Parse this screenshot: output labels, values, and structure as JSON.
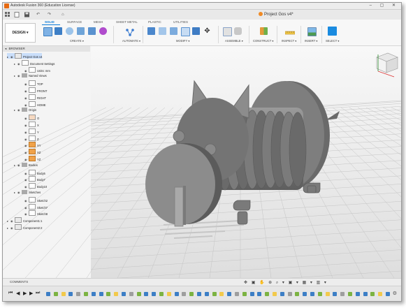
{
  "app": {
    "window_title": "Autodesk Fusion 360 (Education License)",
    "document_tab": "Project Gos v4*",
    "window_controls": "– ▢ ✕"
  },
  "quick_access": {
    "grid_icon": "grid-icon",
    "file_icon": "file-icon",
    "save_icon": "save-icon",
    "undo_icon": "undo-icon",
    "redo_icon": "redo-icon",
    "home_icon": "home-icon"
  },
  "ribbon": {
    "workspace": "DESIGN ▾",
    "tabs": [
      "SOLID",
      "SURFACE",
      "MESH",
      "SHEET METAL",
      "PLASTIC",
      "UTILITIES"
    ],
    "active_tab": "SOLID",
    "groups": [
      "CREATE ▾",
      "AUTOMATE ▾",
      "MODIFY ▾",
      "ASSEMBLE ▾",
      "CONSTRUCT ▾",
      "INSPECT ▾",
      "INSERT ▾",
      "SELECT ▾"
    ],
    "accent": "#0a7bd8"
  },
  "browser": {
    "title": "BROWSER",
    "items": [
      {
        "label": "Project Gos v4",
        "indent": 0,
        "icon": "component",
        "selected": true
      },
      {
        "label": "Document Settings",
        "indent": 1,
        "icon": "gear"
      },
      {
        "label": "Units: mm",
        "indent": 2,
        "icon": "file"
      },
      {
        "label": "Named Views",
        "indent": 1,
        "icon": "folder"
      },
      {
        "label": "TOP",
        "indent": 2,
        "icon": "view"
      },
      {
        "label": "FRONT",
        "indent": 2,
        "icon": "view"
      },
      {
        "label": "RIGHT",
        "indent": 2,
        "icon": "view"
      },
      {
        "label": "HOME",
        "indent": 2,
        "icon": "view"
      },
      {
        "label": "Origin",
        "indent": 1,
        "icon": "folder"
      },
      {
        "label": "O",
        "indent": 2,
        "icon": "origin"
      },
      {
        "label": "X",
        "indent": 2,
        "icon": "axis"
      },
      {
        "label": "Y",
        "indent": 2,
        "icon": "axis"
      },
      {
        "label": "Z",
        "indent": 2,
        "icon": "axis"
      },
      {
        "label": "XY",
        "indent": 2,
        "icon": "plane"
      },
      {
        "label": "XZ",
        "indent": 2,
        "icon": "plane"
      },
      {
        "label": "YZ",
        "indent": 2,
        "icon": "plane"
      },
      {
        "label": "Bodies",
        "indent": 1,
        "icon": "folder"
      },
      {
        "label": "Body5",
        "indent": 2,
        "icon": "body"
      },
      {
        "label": "Body7",
        "indent": 2,
        "icon": "body"
      },
      {
        "label": "Body10",
        "indent": 2,
        "icon": "body"
      },
      {
        "label": "Sketches",
        "indent": 1,
        "icon": "folder"
      },
      {
        "label": "Sketch2",
        "indent": 2,
        "icon": "sketch"
      },
      {
        "label": "Sketch7",
        "indent": 2,
        "icon": "sketch"
      },
      {
        "label": "Sketch8",
        "indent": 2,
        "icon": "sketch"
      },
      {
        "label": "Component1:1",
        "indent": 0,
        "icon": "component"
      },
      {
        "label": "Component2:2",
        "indent": 0,
        "icon": "component"
      }
    ]
  },
  "comments_label": "COMMENTS",
  "nav_bar": "✥ ▣ ✋ ⊕ ⌕ ▾ ▣ ▾ ▦ ▾ ▥ ▾",
  "timeline_controls": [
    "⏮",
    "◀",
    "▶",
    "▶",
    "⏭"
  ]
}
